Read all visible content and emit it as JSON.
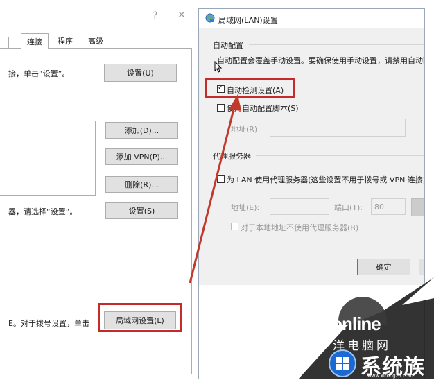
{
  "left_dialog": {
    "help_label": "?",
    "close_label": "✕",
    "tabs": [
      {
        "label": "连接"
      },
      {
        "label": "程序"
      },
      {
        "label": "高级"
      }
    ],
    "setup_text": "接，单击“设置”。",
    "setup_button": "设置(U)",
    "add_button": "添加(D)...",
    "add_vpn_button": "添加 VPN(P)...",
    "delete_button": "删除(R)...",
    "proxy_text": "器，请选择“设置”。",
    "settings_button": "设置(S)",
    "lan_text": "E。对于拨号设置，单击",
    "lan_button": "局域网设置(L)"
  },
  "lan_dialog": {
    "title": "局域网(LAN)设置",
    "auto_config_group": "自动配置",
    "auto_config_desc": "自动配置会覆盖手动设置。要确保使用手动设置，请禁用自动配",
    "auto_detect_label": "自动检测设置(A)",
    "auto_detect_checked": true,
    "use_script_label": "使用自动配置脚本(S)",
    "use_script_checked": false,
    "address_label": "地址(R)",
    "proxy_group": "代理服务器",
    "use_proxy_label": "为 LAN 使用代理服务器(这些设置不用于拨号或 VPN 连接)",
    "proxy_address_label": "地址(E):",
    "port_label": "端口(T):",
    "port_value": "80",
    "bypass_label": "对于本地地址不使用代理服务器(B)",
    "ok_button": "确定"
  },
  "watermark": {
    "pconline": "PConline",
    "pconline_cn": "太平洋电脑网",
    "site": "系统族",
    "site_url": "www.xitongzu.com"
  },
  "colors": {
    "highlight": "#c42b2b",
    "arrow": "#c0392b",
    "dialog_bg": "#ffffff",
    "gray_panel": "#f0f0f0",
    "watermark_blue": "#1b6ad3"
  }
}
